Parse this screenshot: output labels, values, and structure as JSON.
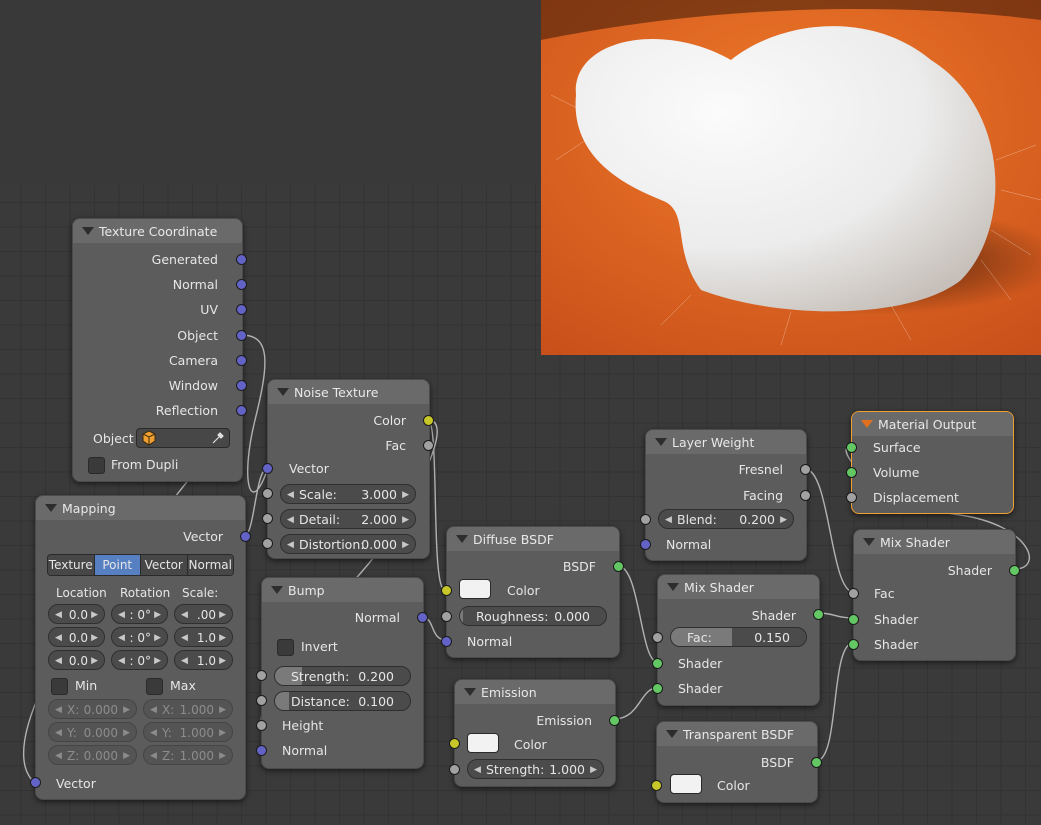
{
  "nodes": {
    "texcoord": {
      "title": "Texture Coordinate",
      "outputs": [
        "Generated",
        "Normal",
        "UV",
        "Object",
        "Camera",
        "Window",
        "Reflection"
      ],
      "object_label": "Object",
      "from_dupli": "From Dupli"
    },
    "mapping": {
      "title": "Mapping",
      "output": "Vector",
      "modes": [
        "Texture",
        "Point",
        "Vector",
        "Normal"
      ],
      "active_mode": "Point",
      "col_headers": [
        "Location",
        "Rotation",
        "Scale:"
      ],
      "location": [
        "0.0",
        "0.0",
        "0.0"
      ],
      "rotation": [
        ": 0°",
        ": 0°",
        ": 0°"
      ],
      "scale": [
        ".00",
        "1.0",
        "1.0"
      ],
      "min_label": "Min",
      "max_label": "Max",
      "min": [
        {
          "axis": "X:",
          "value": "0.000"
        },
        {
          "axis": "Y:",
          "value": "0.000"
        },
        {
          "axis": "Z:",
          "value": "0.000"
        }
      ],
      "max": [
        {
          "axis": "X:",
          "value": "1.000"
        },
        {
          "axis": "Y:",
          "value": "1.000"
        },
        {
          "axis": "Z:",
          "value": "1.000"
        }
      ],
      "input": "Vector"
    },
    "noise": {
      "title": "Noise Texture",
      "outputs": [
        "Color",
        "Fac"
      ],
      "input": "Vector",
      "fields": [
        {
          "label": "Scale:",
          "value": "3.000"
        },
        {
          "label": "Detail:",
          "value": "2.000"
        },
        {
          "label": "Distortion:",
          "value": "0.000"
        }
      ]
    },
    "bump": {
      "title": "Bump",
      "output": "Normal",
      "invert": "Invert",
      "fields": [
        {
          "label": "Strength:",
          "value": "0.200",
          "fill": 0.2
        },
        {
          "label": "Distance:",
          "value": "0.100",
          "fill": 0.1
        }
      ],
      "inputs": [
        "Height",
        "Normal"
      ]
    },
    "diffuse": {
      "title": "Diffuse BSDF",
      "output": "BSDF",
      "color_label": "Color",
      "roughness": {
        "label": "Roughness:",
        "value": "0.000"
      },
      "normal": "Normal"
    },
    "emission": {
      "title": "Emission",
      "output": "Emission",
      "color_label": "Color",
      "strength": {
        "label": "Strength:",
        "value": "1.000"
      }
    },
    "layerweight": {
      "title": "Layer Weight",
      "outputs": [
        "Fresnel",
        "Facing"
      ],
      "blend": {
        "label": "Blend:",
        "value": "0.200"
      },
      "normal": "Normal"
    },
    "mix1": {
      "title": "Mix Shader",
      "output": "Shader",
      "fac": {
        "label": "Fac:",
        "value": "0.150",
        "fill": 0.15
      },
      "inputs": [
        "Shader",
        "Shader"
      ]
    },
    "transparent": {
      "title": "Transparent BSDF",
      "output": "BSDF",
      "color_label": "Color"
    },
    "output": {
      "title": "Material Output",
      "inputs": [
        "Surface",
        "Volume",
        "Displacement"
      ]
    },
    "mix2": {
      "title": "Mix Shader",
      "output": "Shader",
      "inputs": [
        "Fac",
        "Shader",
        "Shader"
      ]
    }
  },
  "colors": {
    "socket_vector": "#6363c7",
    "socket_float": "#a1a1a1",
    "socket_shader": "#63c763",
    "socket_color": "#c7c729",
    "active_border": "#f0a030",
    "render_background": "#e2651f"
  }
}
